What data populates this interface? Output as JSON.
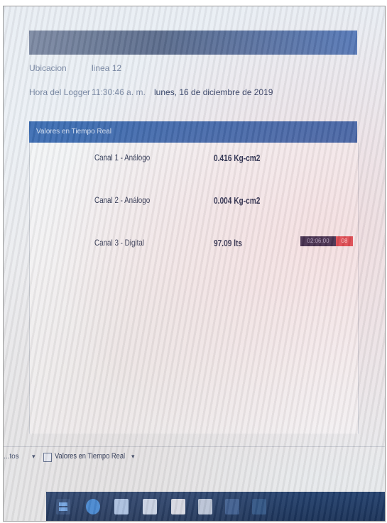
{
  "header": {
    "location_label": "Ubicacion",
    "location_value": "linea 12",
    "logger_time_label": "Hora del Logger",
    "logger_time_value": "11:30:46 a. m.",
    "logger_date_value": "lunes, 16 de diciembre de 2019"
  },
  "section": {
    "title": "Valores en Tiempo Real"
  },
  "channels": [
    {
      "label": "Canal 1 - Análogo",
      "value": "0.416 Kg-cm2"
    },
    {
      "label": "Canal 2 - Análogo",
      "value": "0.004 Kg-cm2"
    },
    {
      "label": "Canal 3 - Digital",
      "value": "97.09 lts",
      "timestamp": "02:06:00",
      "alert": "08"
    }
  ],
  "tabs": {
    "left_label": "...tos",
    "active_label": "Valores en Tiempo Real"
  },
  "icons": [
    "windows-start-icon",
    "edge-browser-icon",
    "file-explorer-icon",
    "store-icon",
    "app-icon"
  ],
  "colors": {
    "header_bar": "#4f77b8",
    "section_bar": "#3b6db3",
    "timestamp_bg": "#14123a",
    "alert_bg": "#d8353e",
    "taskbar": "#1a3258"
  }
}
